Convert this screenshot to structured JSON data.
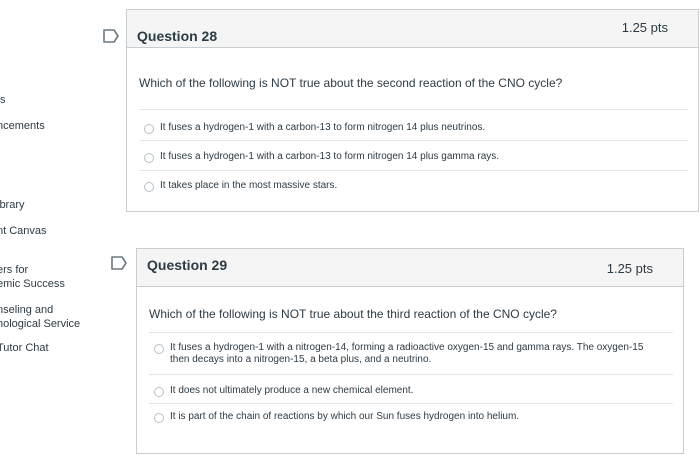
{
  "nav": {
    "items": [
      "s",
      "ncements",
      "ibrary",
      "nt Canvas",
      "ers for",
      "emic Success",
      "nseling and",
      "hological Service",
      "Tutor Chat"
    ]
  },
  "questions": [
    {
      "title": "Question 28",
      "points": "1.25 pts",
      "prompt": "Which of the following is NOT true about the second reaction of the CNO cycle?",
      "answers": [
        "It fuses a hydrogen-1 with a carbon-13 to form nitrogen 14 plus neutrinos.",
        "It fuses a hydrogen-1 with a carbon-13 to form nitrogen 14 plus gamma rays.",
        "It takes place in the most massive stars."
      ]
    },
    {
      "title": "Question 29",
      "points": "1.25 pts",
      "prompt": "Which of the following is NOT true about the third reaction of the CNO cycle?",
      "answers": [
        "It fuses a hydrogen-1 with a nitrogen-14, forming a radioactive oxygen-15 and gamma rays. The oxygen-15",
        "then decays into a nitrogen-15, a beta plus, and a neutrino.",
        "It does not ultimately produce a new chemical element.",
        "It is part of the chain of reactions by which our Sun fuses hydrogen into helium."
      ]
    }
  ],
  "icons": {
    "flag": "flag-question-icon",
    "radio": "radio-button-icon"
  },
  "colors": {
    "header_bg": "#f5f5f5",
    "border": "#c7cdd1",
    "text": "#2d3b45"
  }
}
